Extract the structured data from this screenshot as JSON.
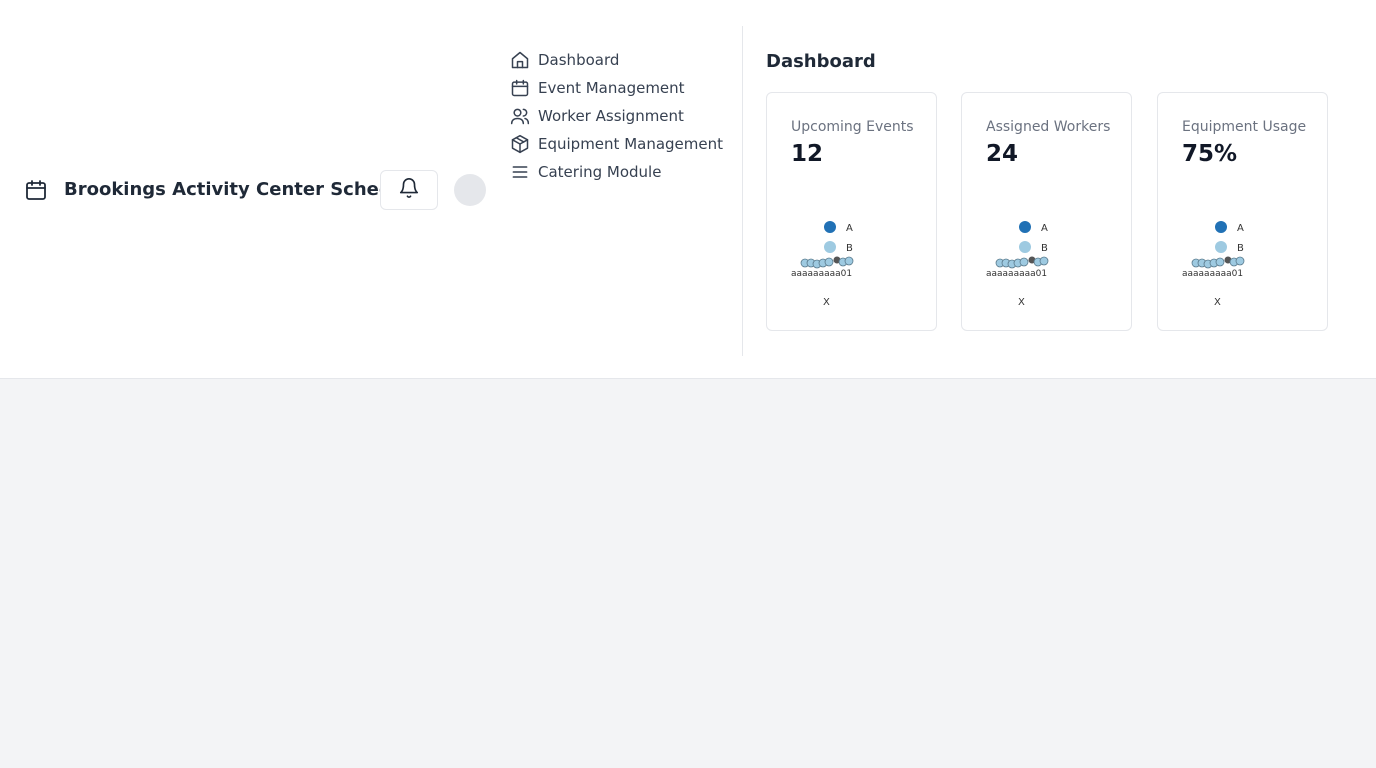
{
  "header": {
    "title": "Brookings Activity Center Scheduler",
    "brand_icon": "calendar-icon",
    "notification_icon": "bell-icon"
  },
  "nav": {
    "items": [
      {
        "label": "Dashboard",
        "icon": "home-icon"
      },
      {
        "label": "Event Management",
        "icon": "calendar-icon"
      },
      {
        "label": "Worker Assignment",
        "icon": "users-icon"
      },
      {
        "label": "Equipment Management",
        "icon": "box-icon"
      },
      {
        "label": "Catering Module",
        "icon": "menu-icon"
      }
    ]
  },
  "dashboard": {
    "title": "Dashboard",
    "cards": [
      {
        "title": "Upcoming Events",
        "value": "12"
      },
      {
        "title": "Assigned Workers",
        "value": "24"
      },
      {
        "title": "Equipment Usage",
        "value": "75%"
      }
    ]
  },
  "chart_legend": {
    "series_a": "A",
    "series_b": "B",
    "xlabel": "X",
    "tick_text": "aaaaaaaaa01"
  },
  "colors": {
    "series_a": "#2171b5",
    "series_b": "#9ecae1",
    "border": "#e5e7eb"
  }
}
